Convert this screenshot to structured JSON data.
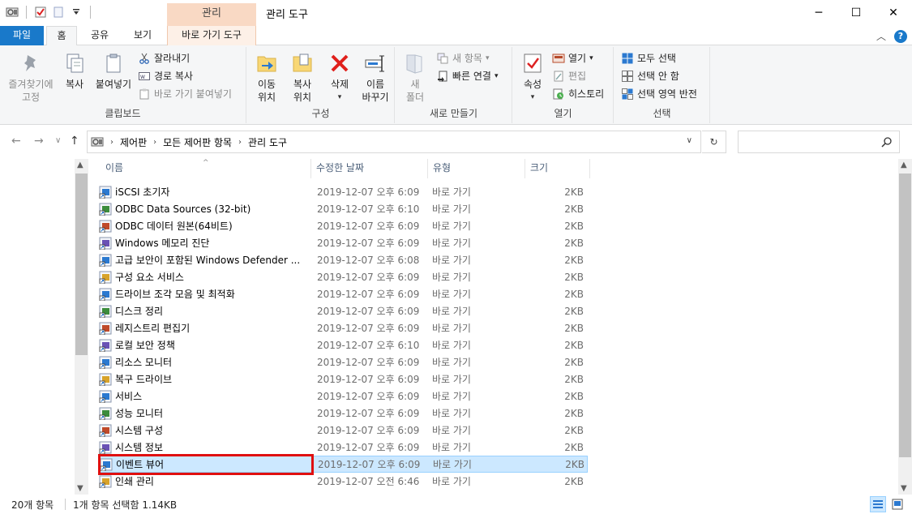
{
  "window": {
    "title": "관리 도구",
    "context_tab_header": "관리",
    "controls": {
      "minimize": "─",
      "maximize": "☐",
      "close": "✕"
    }
  },
  "ribbon_tabs": {
    "file": "파일",
    "home": "홈",
    "share": "공유",
    "view": "보기",
    "shortcut_tools": "바로 가기 도구"
  },
  "ribbon": {
    "clipboard": {
      "label": "클립보드",
      "pin": "즐겨찾기에\n고정",
      "copy": "복사",
      "paste": "붙여넣기",
      "cut": "잘라내기",
      "copy_path": "경로 복사",
      "paste_shortcut": "바로 가기 붙여넣기"
    },
    "organize": {
      "label": "구성",
      "move_to": "이동\n위치",
      "copy_to": "복사\n위치",
      "delete": "삭제",
      "rename": "이름\n바꾸기"
    },
    "new": {
      "label": "새로 만들기",
      "new_folder": "새\n폴더",
      "new_item": "새 항목",
      "easy_access": "빠른 연결"
    },
    "open": {
      "label": "열기",
      "properties": "속성",
      "open": "열기",
      "edit": "편집",
      "history": "히스토리"
    },
    "select": {
      "label": "선택",
      "select_all": "모두 선택",
      "select_none": "선택 안 함",
      "invert": "선택 영역 반전"
    }
  },
  "address": {
    "crumbs": [
      "제어판",
      "모든 제어판 항목",
      "관리 도구"
    ],
    "search_placeholder": ""
  },
  "columns": {
    "name": "이름",
    "date": "수정한 날짜",
    "type": "유형",
    "size": "크기"
  },
  "files": [
    {
      "name": "iSCSI 초기자",
      "date": "2019-12-07 오후 6:09",
      "type": "바로 가기",
      "size": "2KB"
    },
    {
      "name": "ODBC Data Sources (32-bit)",
      "date": "2019-12-07 오후 6:10",
      "type": "바로 가기",
      "size": "2KB"
    },
    {
      "name": "ODBC 데이터 원본(64비트)",
      "date": "2019-12-07 오후 6:09",
      "type": "바로 가기",
      "size": "2KB"
    },
    {
      "name": "Windows 메모리 진단",
      "date": "2019-12-07 오후 6:09",
      "type": "바로 가기",
      "size": "2KB"
    },
    {
      "name": "고급 보안이 포함된 Windows Defender ...",
      "date": "2019-12-07 오후 6:08",
      "type": "바로 가기",
      "size": "2KB"
    },
    {
      "name": "구성 요소 서비스",
      "date": "2019-12-07 오후 6:09",
      "type": "바로 가기",
      "size": "2KB"
    },
    {
      "name": "드라이브 조각 모음 및 최적화",
      "date": "2019-12-07 오후 6:09",
      "type": "바로 가기",
      "size": "2KB"
    },
    {
      "name": "디스크 정리",
      "date": "2019-12-07 오후 6:09",
      "type": "바로 가기",
      "size": "2KB"
    },
    {
      "name": "레지스트리 편집기",
      "date": "2019-12-07 오후 6:09",
      "type": "바로 가기",
      "size": "2KB"
    },
    {
      "name": "로컬 보안 정책",
      "date": "2019-12-07 오후 6:10",
      "type": "바로 가기",
      "size": "2KB"
    },
    {
      "name": "리소스 모니터",
      "date": "2019-12-07 오후 6:09",
      "type": "바로 가기",
      "size": "2KB"
    },
    {
      "name": "복구 드라이브",
      "date": "2019-12-07 오후 6:09",
      "type": "바로 가기",
      "size": "2KB"
    },
    {
      "name": "서비스",
      "date": "2019-12-07 오후 6:09",
      "type": "바로 가기",
      "size": "2KB"
    },
    {
      "name": "성능 모니터",
      "date": "2019-12-07 오후 6:09",
      "type": "바로 가기",
      "size": "2KB"
    },
    {
      "name": "시스템 구성",
      "date": "2019-12-07 오후 6:09",
      "type": "바로 가기",
      "size": "2KB"
    },
    {
      "name": "시스템 정보",
      "date": "2019-12-07 오후 6:09",
      "type": "바로 가기",
      "size": "2KB"
    },
    {
      "name": "이벤트 뷰어",
      "date": "2019-12-07 오후 6:09",
      "type": "바로 가기",
      "size": "2KB",
      "selected": true
    },
    {
      "name": "인쇄 관리",
      "date": "2019-12-07 오전 6:46",
      "type": "바로 가기",
      "size": "2KB"
    }
  ],
  "status": {
    "count": "20개 항목",
    "selection": "1개 항목 선택함 1.14KB"
  },
  "colors": {
    "accent": "#1979ca",
    "context_tab": "#f9d9c4",
    "selection_bg": "#cce8ff",
    "highlight_box": "#e01010"
  }
}
